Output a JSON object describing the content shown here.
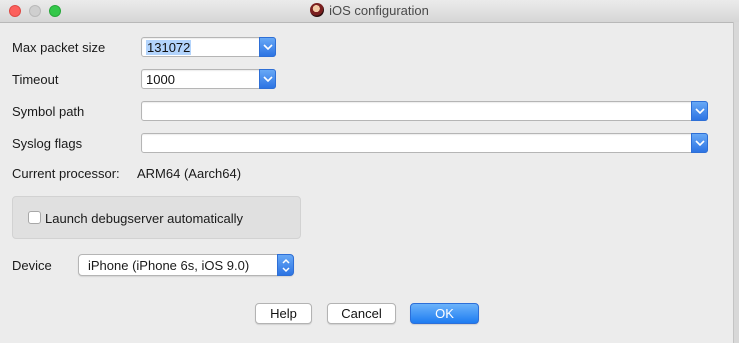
{
  "window": {
    "title": "iOS configuration",
    "app_icon": "ida-portrait-icon"
  },
  "fields": {
    "max_packet": {
      "label": "Max packet size",
      "value": "131072"
    },
    "timeout": {
      "label": "Timeout",
      "value": "1000"
    },
    "symbol_path": {
      "label": "Symbol path",
      "value": ""
    },
    "syslog_flags": {
      "label": "Syslog flags",
      "value": ""
    }
  },
  "processor": {
    "label": "Current processor:",
    "value": "ARM64 (Aarch64)"
  },
  "options": {
    "launch_debugserver": {
      "label": "Launch debugserver automatically",
      "checked": false
    }
  },
  "device": {
    "label": "Device",
    "selected": "iPhone (iPhone 6s, iOS 9.0)"
  },
  "buttons": {
    "help": "Help",
    "cancel": "Cancel",
    "ok": "OK"
  },
  "colors": {
    "accent": "#2d74e3",
    "window_bg": "#ececec"
  }
}
